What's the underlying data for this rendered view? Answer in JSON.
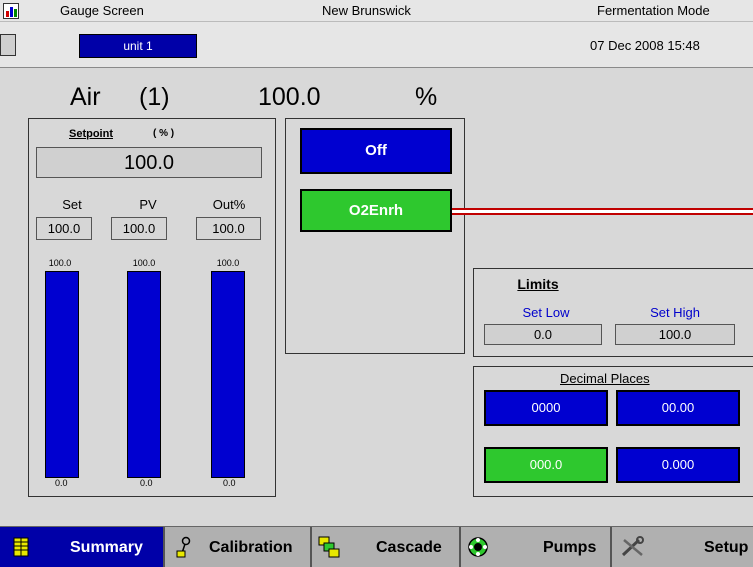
{
  "title_bar": {
    "screen_name": "Gauge Screen",
    "company": "New Brunswick",
    "mode": "Fermentation Mode"
  },
  "unit_bar": {
    "unit_tab": "unit 1",
    "datetime": "07 Dec 2008   15:48"
  },
  "header": {
    "name": "Air",
    "index": "(1)",
    "value": "100.0",
    "unit": "%"
  },
  "setpoint": {
    "label": "Setpoint",
    "unit": "( % )",
    "value": "100.0"
  },
  "columns": [
    {
      "label": "Set",
      "value": "100.0",
      "max": "100.0",
      "min": "0.0",
      "level": 1.0
    },
    {
      "label": "PV",
      "value": "100.0",
      "max": "100.0",
      "min": "0.0",
      "level": 1.0
    },
    {
      "label": "Out%",
      "value": "100.0",
      "max": "100.0",
      "min": "0.0",
      "level": 1.0
    }
  ],
  "controls": {
    "off_label": "Off",
    "o2_label": "O2Enrh"
  },
  "limits": {
    "title": "Limits",
    "set_low_label": "Set Low",
    "set_high_label": "Set High",
    "set_low_value": "0.0",
    "set_high_value": "100.0"
  },
  "decimal_places": {
    "title": "Decimal Places",
    "options": [
      "0000",
      "00.00",
      "000.0",
      "0.000"
    ],
    "selected": "000.0"
  },
  "nav": {
    "summary": "Summary",
    "calibration": "Calibration",
    "cascade": "Cascade",
    "pumps": "Pumps",
    "setup": "Setup"
  },
  "colors": {
    "blue": "#0000d0",
    "green": "#2ec82e",
    "red_line": "#c00000",
    "nav_active": "#0000a8"
  }
}
